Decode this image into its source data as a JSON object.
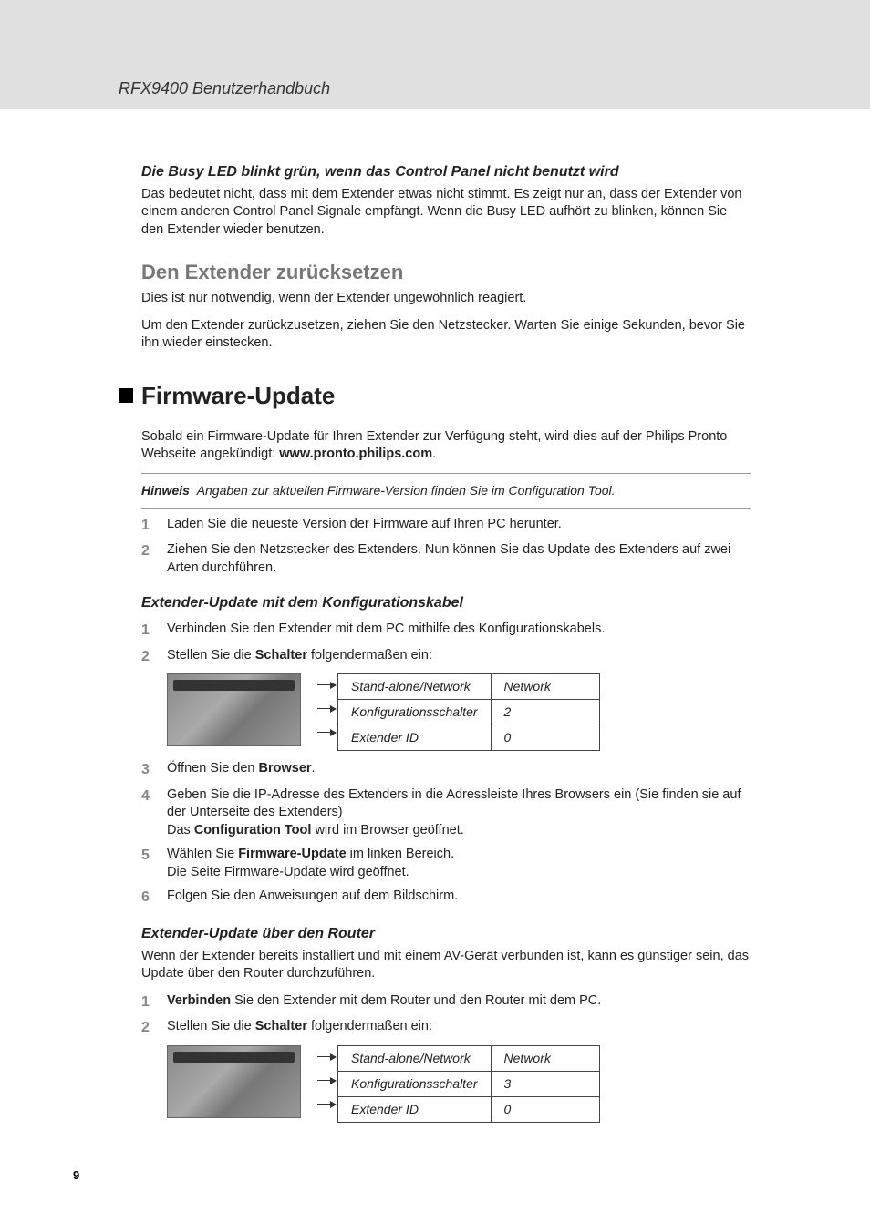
{
  "header": {
    "title": "RFX9400 Benutzerhandbuch"
  },
  "section1": {
    "heading": "Die Busy LED blinkt grün, wenn das Control Panel nicht benutzt wird",
    "body": "Das bedeutet nicht, dass mit dem Extender etwas nicht stimmt. Es zeigt nur an, dass der Extender von einem anderen Control Panel Signale empfängt. Wenn die Busy LED aufhört zu blinken, können Sie den Extender wieder benutzen."
  },
  "section2": {
    "heading": "Den Extender zurücksetzen",
    "p1": "Dies ist nur notwendig, wenn der Extender ungewöhnlich reagiert.",
    "p2": "Um den Extender zurückzusetzen, ziehen Sie den Netzstecker. Warten Sie einige Sekunden, bevor Sie ihn wieder einstecken."
  },
  "firmware": {
    "title": "Firmware-Update",
    "intro_a": "Sobald ein Firmware-Update für Ihren Extender zur Verfügung steht, wird dies auf der Philips Pronto Webseite angekündigt: ",
    "intro_b": "www.pronto.philips.com",
    "intro_c": ".",
    "note_label": "Hinweis",
    "note_text": "Angaben zur aktuellen Firmware-Version finden Sie im Configuration Tool.",
    "step1": "Laden Sie die neueste Version der Firmware auf Ihren PC herunter.",
    "step2": "Ziehen Sie den Netzstecker des Extenders. Nun können Sie das Update des Extenders auf zwei Arten durchführen."
  },
  "cable": {
    "heading": "Extender-Update mit dem Konfigurationskabel",
    "s1": "Verbinden Sie den Extender mit dem PC mithilfe des Konfigurationskabels.",
    "s2a": "Stellen Sie die ",
    "s2b": "Schalter",
    "s2c": " folgendermaßen ein:",
    "table": {
      "r1k": "Stand-alone/Network",
      "r1v": "Network",
      "r2k": "Konfigurationsschalter",
      "r2v": "2",
      "r3k": "Extender ID",
      "r3v": "0"
    },
    "s3a": "Öffnen Sie den ",
    "s3b": "Browser",
    "s3c": ".",
    "s4a": "Geben Sie die IP-Adresse des Extenders in die Adressleiste Ihres Browsers ein (Sie finden sie auf der Unterseite des Extenders)",
    "s4b": "Das ",
    "s4c": "Configuration Tool",
    "s4d": " wird im Browser geöffnet.",
    "s5a": "Wählen Sie ",
    "s5b": "Firmware-Update",
    "s5c": " im linken Bereich.",
    "s5d": "Die Seite Firmware-Update wird geöffnet.",
    "s6": "Folgen Sie den Anweisungen auf dem Bildschirm."
  },
  "router": {
    "heading": "Extender-Update über den Router",
    "intro": "Wenn der Extender bereits installiert und mit einem AV-Gerät verbunden ist, kann es günstiger sein, das Update über den Router durchzuführen.",
    "s1a": "Verbinden",
    "s1b": " Sie den Extender mit dem Router und den Router mit dem PC.",
    "s2a": "Stellen Sie die ",
    "s2b": "Schalter",
    "s2c": " folgendermaßen ein:",
    "table": {
      "r1k": "Stand-alone/Network",
      "r1v": "Network",
      "r2k": "Konfigurationsschalter",
      "r2v": "3",
      "r3k": "Extender ID",
      "r3v": "0"
    }
  },
  "nums": {
    "n1": "1",
    "n2": "2",
    "n3": "3",
    "n4": "4",
    "n5": "5",
    "n6": "6"
  },
  "page_number": "9"
}
